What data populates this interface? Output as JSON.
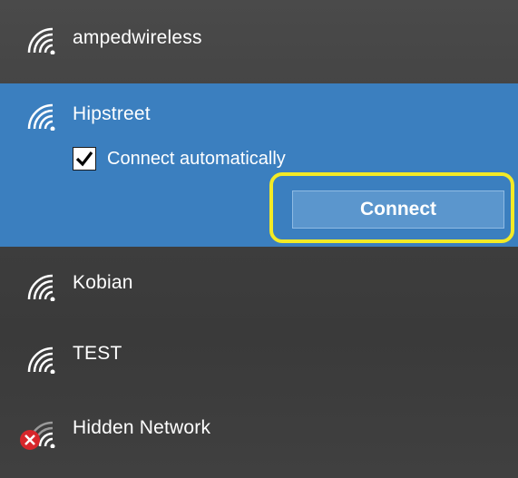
{
  "networks": [
    {
      "name": "ampedwireless",
      "icon": "wifi-signal-icon"
    },
    {
      "name": "Hipstreet",
      "icon": "wifi-signal-icon",
      "selected": true
    },
    {
      "name": "Kobian",
      "icon": "wifi-signal-icon"
    },
    {
      "name": "TEST",
      "icon": "wifi-signal-icon"
    },
    {
      "name": "Hidden Network",
      "icon": "wifi-signal-icon",
      "status_icon": "error-x-icon"
    }
  ],
  "selected_network": {
    "auto_connect_label": "Connect automatically",
    "auto_connect_checked": true,
    "connect_label": "Connect"
  },
  "colors": {
    "selected_bg": "#3b7fbf",
    "button_bg": "#5b96cd",
    "highlight": "#f3ea25",
    "error": "#d7262b"
  }
}
